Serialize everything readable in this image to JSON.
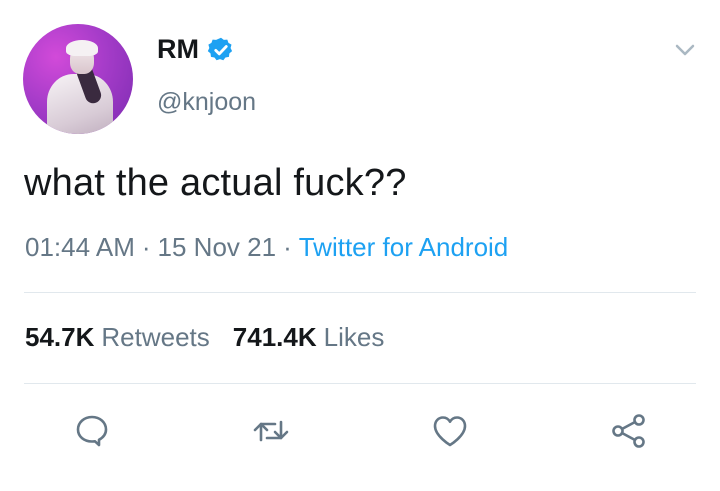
{
  "author": {
    "display_name": "RM",
    "handle": "@knjoon",
    "verified": true
  },
  "tweet": {
    "text": "what the actual fuck??"
  },
  "meta": {
    "time": "01:44 AM",
    "separator": "·",
    "date": "15 Nov 21",
    "source": "Twitter for Android"
  },
  "stats": {
    "retweets_count": "54.7K",
    "retweets_label": "Retweets",
    "likes_count": "741.4K",
    "likes_label": "Likes"
  },
  "icons": {
    "menu": "chevron-down-icon",
    "verified": "verified-badge-icon",
    "reply": "reply-icon",
    "retweet": "retweet-icon",
    "like": "heart-icon",
    "share": "share-icon"
  },
  "colors": {
    "accent": "#1da1f2",
    "text": "#14171a",
    "secondary": "#657786",
    "divider": "#e1e8ed"
  }
}
